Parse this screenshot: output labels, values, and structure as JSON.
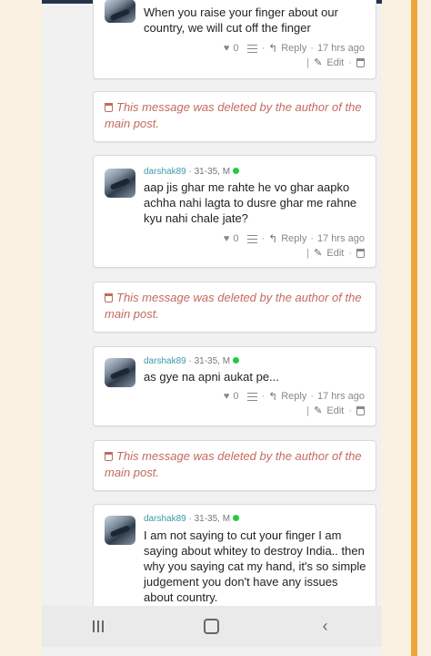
{
  "comments": [
    {
      "message": "When you raise your finger about our country, we will cut off the finger",
      "likes": "0",
      "reply": "Reply",
      "time": "17 hrs ago",
      "edit": "Edit"
    },
    {
      "user": "darshak89",
      "demo": " · 31-35, M",
      "message": "aap jis ghar me rahte he vo ghar aapko achha nahi lagta to dusre ghar me rahne kyu nahi chale jate?",
      "likes": "0",
      "reply": "Reply",
      "time": "17 hrs ago",
      "edit": "Edit"
    },
    {
      "user": "darshak89",
      "demo": " · 31-35, M",
      "message": "as gye na apni aukat pe...",
      "likes": "0",
      "reply": "Reply",
      "time": "17 hrs ago",
      "edit": "Edit"
    },
    {
      "user": "darshak89",
      "demo": " · 31-35, M",
      "message": "I am not saying to cut your finger I am saying about whitey to destroy India.. then why you saying cat my hand, it's so simple judgement you don't have any issues about country."
    }
  ],
  "deleted_notice": "This message was deleted by the author of the main post.",
  "icons": {
    "like": "heart-icon",
    "list": "list-icon",
    "reply": "reply-arrow-icon",
    "edit": "pencil-icon",
    "delete": "trash-icon",
    "online": "online-dot-icon",
    "nav_recent": "recent-apps-icon",
    "nav_home": "home-icon",
    "nav_back": "back-icon"
  },
  "colors": {
    "username": "#3a9aa8",
    "online": "#27c93f",
    "deleted_text": "#c46a5e",
    "accent_bar": "#f0a53b"
  }
}
